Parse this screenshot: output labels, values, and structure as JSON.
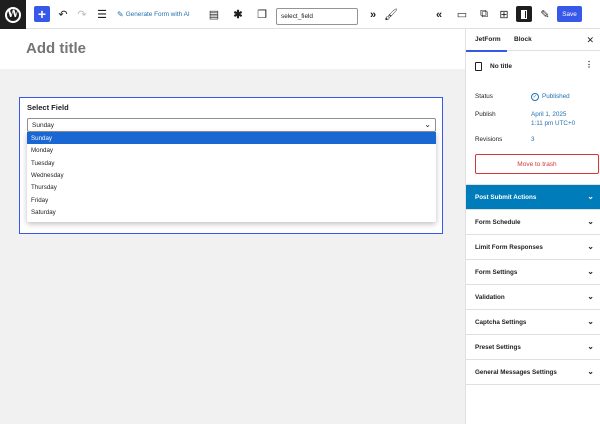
{
  "toolbar": {
    "generate_ai_label": "Generate Form with AI",
    "search_value": "select_field",
    "save_label": "Save"
  },
  "editor": {
    "title_placeholder": "Add title",
    "block_label": "Select Field",
    "selected_value": "Sunday",
    "options": [
      "Sunday",
      "Monday",
      "Tuesday",
      "Wednesday",
      "Thursday",
      "Friday",
      "Saturday"
    ]
  },
  "sidebar": {
    "tabs": [
      "JetForm",
      "Block"
    ],
    "doc_title": "No title",
    "status_label": "Status",
    "status_value": "Published",
    "publish_label": "Publish",
    "publish_date": "April 1, 2025",
    "publish_time": "1:11 pm UTC+0",
    "revisions_label": "Revisions",
    "revisions_value": "3",
    "trash_label": "Move to trash",
    "sections": [
      "Post Submit Actions",
      "Form Schedule",
      "Limit Form Responses",
      "Form Settings",
      "Validation",
      "Captcha Settings",
      "Preset Settings",
      "General Messages Settings"
    ]
  },
  "colors": {
    "accent": "#3858e9",
    "active_section": "#007cba",
    "selected_option": "#1967d2",
    "trash": "#d63638",
    "link": "#2271b1"
  }
}
